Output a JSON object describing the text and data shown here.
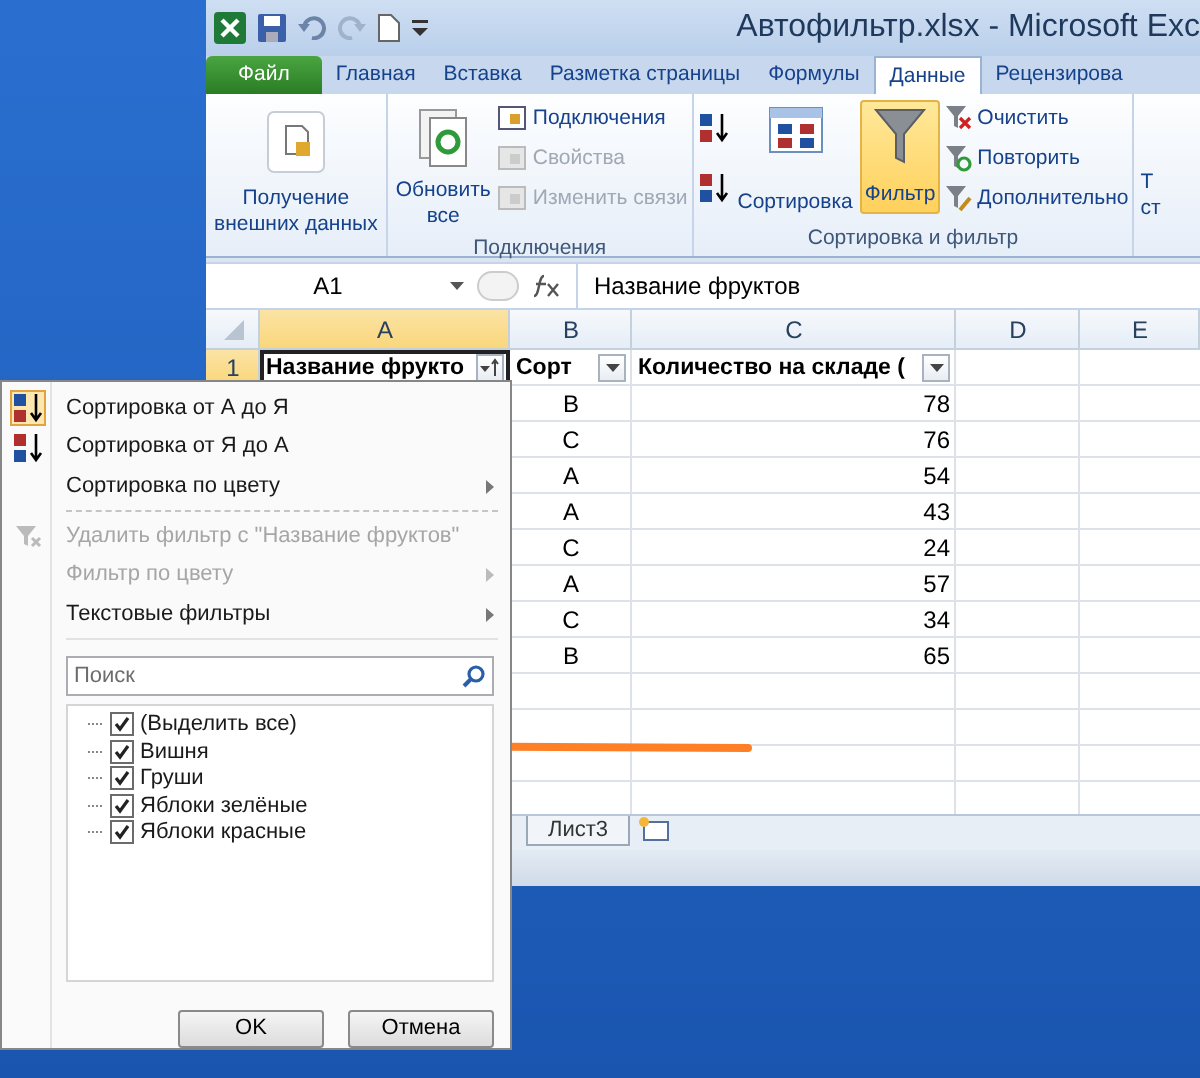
{
  "window": {
    "title": "Автофильтр.xlsx - Microsoft Exc"
  },
  "tabs": [
    {
      "label": "Файл",
      "kind": "file",
      "selected": false
    },
    {
      "label": "Главная",
      "kind": "tab",
      "selected": false
    },
    {
      "label": "Вставка",
      "kind": "tab",
      "selected": false
    },
    {
      "label": "Разметка страницы",
      "kind": "tab",
      "selected": false
    },
    {
      "label": "Формулы",
      "kind": "tab",
      "selected": false
    },
    {
      "label": "Данные",
      "kind": "tab",
      "selected": true
    },
    {
      "label": "Рецензирова",
      "kind": "tab",
      "selected": false
    }
  ],
  "ribbon": {
    "external_data": {
      "label_lines": [
        "Получение",
        "внешних данных"
      ]
    },
    "connections_group": {
      "label": "Подключения",
      "refresh": {
        "label_lines": [
          "Обновить",
          "все"
        ]
      },
      "items": [
        {
          "label": "Подключения",
          "disabled": false
        },
        {
          "label": "Свойства",
          "disabled": true
        },
        {
          "label": "Изменить связи",
          "disabled": true
        }
      ]
    },
    "sort_group": {
      "label": "Сортировка и фильтр",
      "sort": "Сортировка",
      "filter": {
        "label": "Фильтр",
        "selected": true
      },
      "items": [
        {
          "label": "Очистить"
        },
        {
          "label": "Повторить"
        },
        {
          "label": "Дополнительно"
        }
      ]
    },
    "cut_group": {
      "label_lines": [
        "Т",
        "ст"
      ]
    }
  },
  "formula_bar": {
    "name_box": "A1",
    "formula": "Название фруктов"
  },
  "columns": [
    "A",
    "B",
    "C",
    "D",
    "E"
  ],
  "header_row": {
    "number": "1",
    "cells": [
      "Название фрукто",
      "Сорт",
      "Количество на складе ("
    ]
  },
  "rows": [
    {
      "sort": "B",
      "qty": "78"
    },
    {
      "sort": "C",
      "qty": "76"
    },
    {
      "sort": "A",
      "qty": "54"
    },
    {
      "sort": "A",
      "qty": "43"
    },
    {
      "sort": "C",
      "qty": "24"
    },
    {
      "sort": "A",
      "qty": "57"
    },
    {
      "sort": "C",
      "qty": "34"
    },
    {
      "sort": "B",
      "qty": "65"
    }
  ],
  "sheet_tabs": [
    "Лист3"
  ],
  "filter_menu": {
    "items": [
      {
        "kind": "sort-asc",
        "label": "Сортировка от А до Я",
        "disabled": false,
        "submenu": false
      },
      {
        "kind": "sort-desc",
        "label": "Сортировка от Я до А",
        "disabled": false,
        "submenu": false
      },
      {
        "kind": "plain",
        "label": "Сортировка по цвету",
        "disabled": false,
        "submenu": true
      },
      {
        "kind": "separator"
      },
      {
        "kind": "clear",
        "label": "Удалить фильтр с \"Название фруктов\"",
        "disabled": true,
        "submenu": false
      },
      {
        "kind": "plain",
        "label": "Фильтр по цвету",
        "disabled": true,
        "submenu": true
      },
      {
        "kind": "plain",
        "label": "Текстовые фильтры",
        "disabled": false,
        "submenu": true
      }
    ],
    "search": {
      "placeholder": "Поиск"
    },
    "values": [
      {
        "label": "(Выделить все)",
        "checked": true
      },
      {
        "label": "Вишня",
        "checked": true
      },
      {
        "label": "Груши",
        "checked": true
      },
      {
        "label": "Яблоки зелёные",
        "checked": true
      },
      {
        "label": "Яблоки красные",
        "checked": true
      }
    ],
    "buttons": [
      "OK",
      "Отмена"
    ]
  }
}
